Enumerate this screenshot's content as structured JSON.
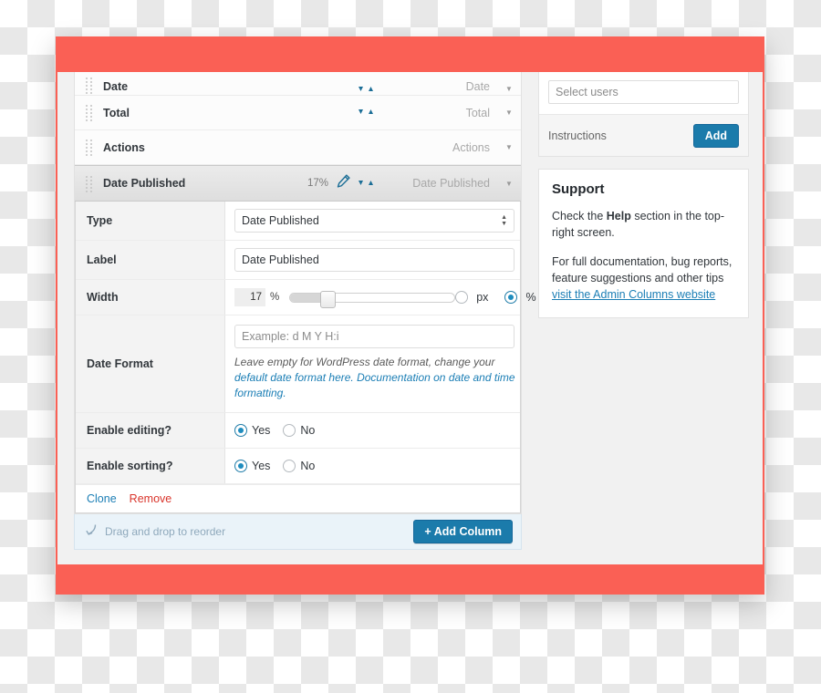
{
  "columns": [
    {
      "name": "Date",
      "type": "Date",
      "width_pct": "",
      "active": false,
      "sortable": true,
      "editable": false
    },
    {
      "name": "Total",
      "type": "Total",
      "width_pct": "",
      "active": false,
      "sortable": true,
      "editable": false
    },
    {
      "name": "Actions",
      "type": "Actions",
      "width_pct": "",
      "active": false,
      "sortable": false,
      "editable": false
    },
    {
      "name": "Date Published",
      "type": "Date Published",
      "width_pct": "17%",
      "active": true,
      "sortable": true,
      "editable": true
    }
  ],
  "settings": {
    "type": {
      "label": "Type",
      "value": "Date Published"
    },
    "label": {
      "label": "Label",
      "value": "Date Published"
    },
    "width": {
      "label": "Width",
      "value": "17",
      "unit_suffix": "%",
      "slider_percent": 17,
      "unit_px_label": "px",
      "unit_pct_label": "%",
      "selected_unit": "%"
    },
    "date_format": {
      "label": "Date Format",
      "value": "",
      "placeholder": "Example: d M Y H:i",
      "help_prefix": "Leave empty for WordPress date format, change your ",
      "help_link_1": "default date format here.",
      "help_link_2": " Documentation on date and time formatting."
    },
    "enable_editing": {
      "label": "Enable editing?",
      "yes": "Yes",
      "no": "No",
      "selected": "Yes"
    },
    "enable_sorting": {
      "label": "Enable sorting?",
      "yes": "Yes",
      "no": "No",
      "selected": "Yes"
    },
    "clone_label": "Clone",
    "remove_label": "Remove"
  },
  "footer": {
    "reorder_hint": "Drag and drop to reorder",
    "add_column_label": "+ Add Column"
  },
  "sidebar": {
    "users_placeholder": "Select users",
    "instructions_label": "Instructions",
    "add_label": "Add",
    "support": {
      "title": "Support",
      "p1_a": "Check the ",
      "p1_bold": "Help",
      "p1_b": " section in the top-right screen.",
      "p2_a": "For full documentation, bug reports, feature suggestions and other tips ",
      "p2_link": "visit the Admin Columns website"
    }
  },
  "colors": {
    "frame_red": "#fa6055",
    "accent_blue": "#1b7bab",
    "link_blue": "#1b7eb5",
    "danger_red": "#d9342b"
  }
}
